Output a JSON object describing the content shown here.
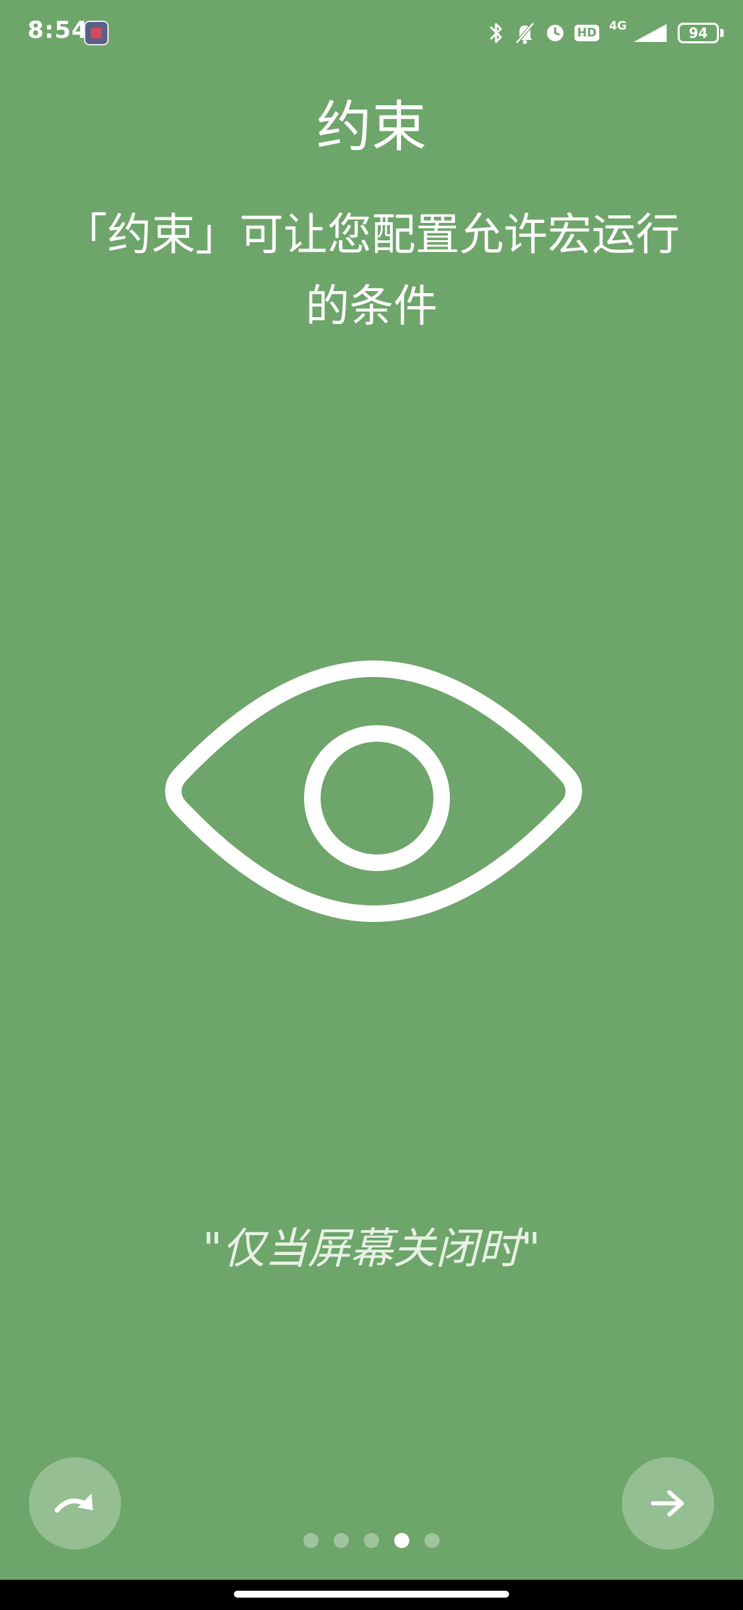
{
  "status_bar": {
    "time": "8:54",
    "network": "4G",
    "hd_label": "HD",
    "battery": "94",
    "icons": [
      "bluetooth-icon",
      "mute-icon",
      "alarm-icon",
      "hd-icon",
      "signal-icon",
      "battery-icon"
    ]
  },
  "intro": {
    "title": "约束",
    "description": "「约束」可让您配置允许宏运行的条件",
    "example": "\"仅当屏幕关闭时\"",
    "illustration_icon": "eye-icon"
  },
  "controls": {
    "skip_icon": "skip-redo-arrow-icon",
    "next_icon": "arrow-right-icon"
  },
  "pager": {
    "total": 5,
    "active_index": 3
  },
  "colors": {
    "background": "#6ea56a",
    "foreground": "#ffffff"
  }
}
